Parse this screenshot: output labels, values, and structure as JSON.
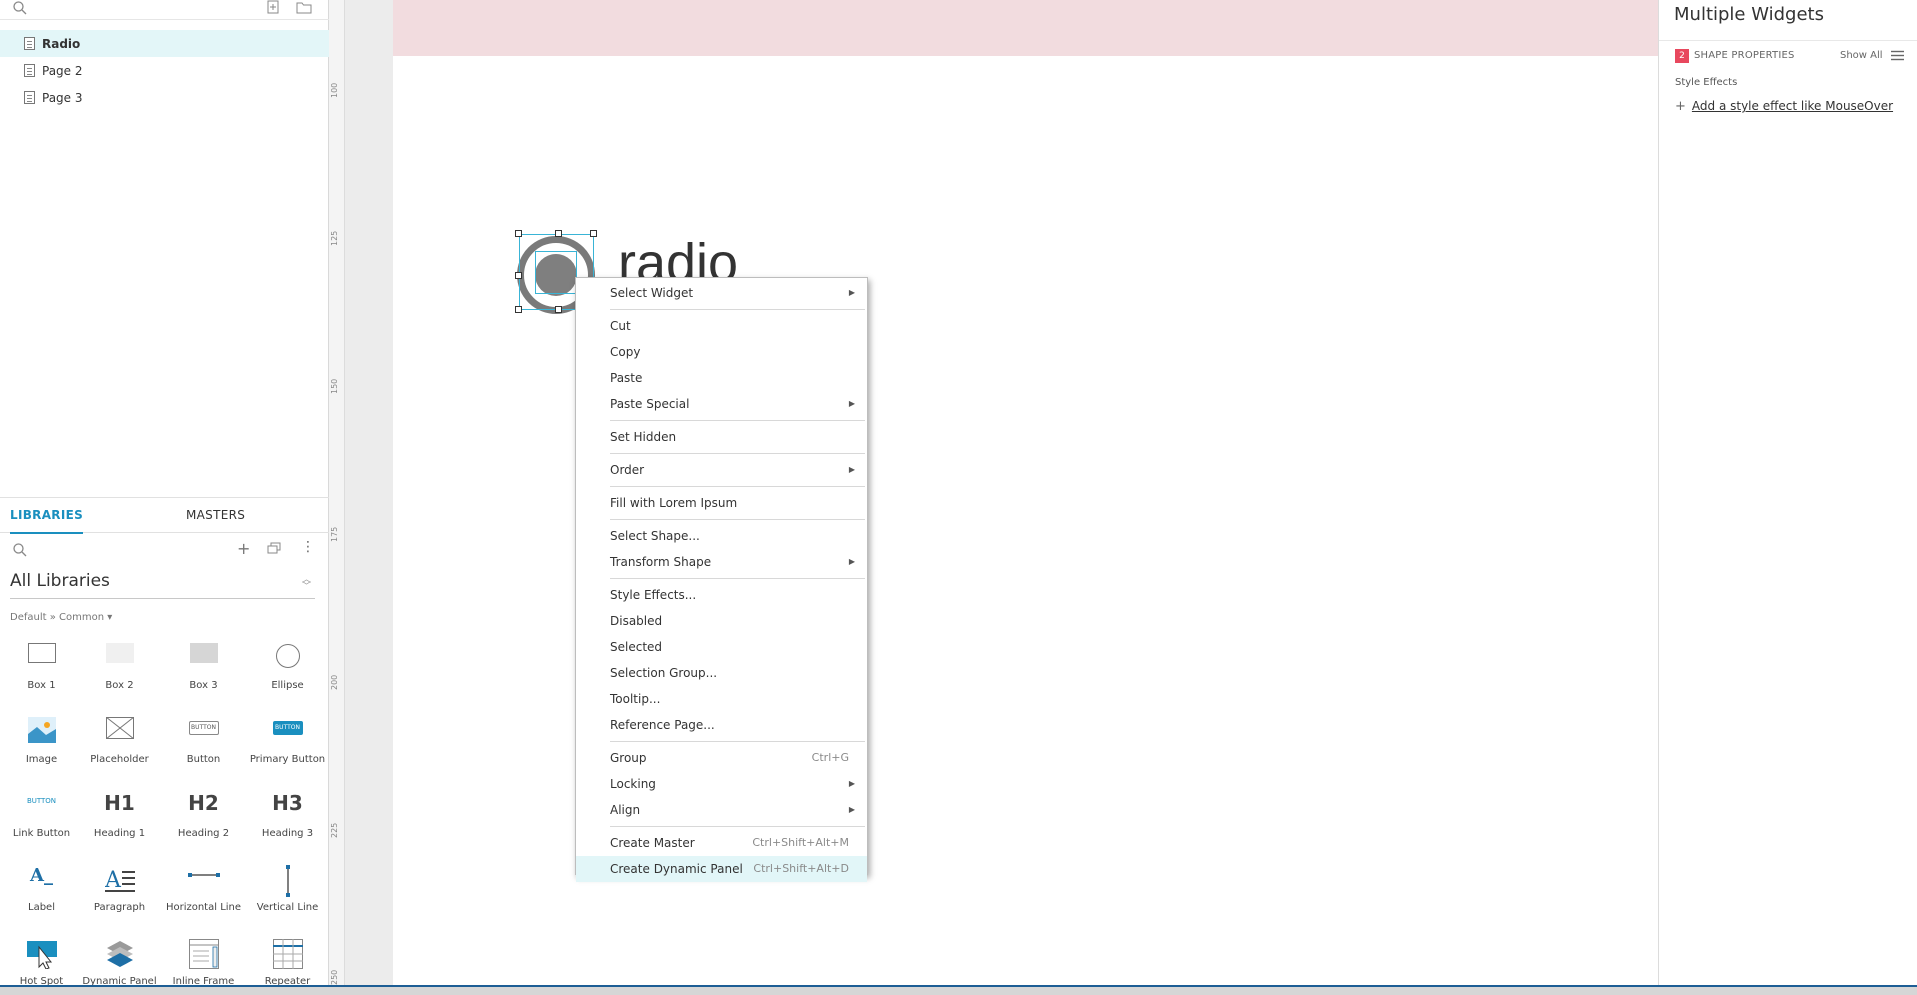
{
  "pages": [
    {
      "label": "Radio",
      "selected": true
    },
    {
      "label": "Page 2",
      "selected": false
    },
    {
      "label": "Page 3",
      "selected": false
    }
  ],
  "libraries": {
    "tabs": [
      "LIBRARIES",
      "MASTERS"
    ],
    "selected_library": "All Libraries",
    "breadcrumb": "Default » Common ▾",
    "widgets": [
      {
        "label": "Box 1",
        "icon": "box1-icon"
      },
      {
        "label": "Box 2",
        "icon": "box2-icon"
      },
      {
        "label": "Box 3",
        "icon": "box3-icon"
      },
      {
        "label": "Ellipse",
        "icon": "ellipse-icon"
      },
      {
        "label": "Image",
        "icon": "image-icon"
      },
      {
        "label": "Placeholder",
        "icon": "placeholder-icon"
      },
      {
        "label": "Button",
        "icon": "button-icon"
      },
      {
        "label": "Primary Button",
        "icon": "primary-button-icon"
      },
      {
        "label": "Link Button",
        "icon": "link-button-icon"
      },
      {
        "label": "Heading 1",
        "icon": "heading1-icon"
      },
      {
        "label": "Heading 2",
        "icon": "heading2-icon"
      },
      {
        "label": "Heading 3",
        "icon": "heading3-icon"
      },
      {
        "label": "Label",
        "icon": "label-icon"
      },
      {
        "label": "Paragraph",
        "icon": "paragraph-icon"
      },
      {
        "label": "Horizontal Line",
        "icon": "horizontal-line-icon"
      },
      {
        "label": "Vertical Line",
        "icon": "vertical-line-icon"
      },
      {
        "label": "Hot Spot",
        "icon": "hot-spot-icon"
      },
      {
        "label": "Dynamic Panel",
        "icon": "dynamic-panel-icon"
      },
      {
        "label": "Inline Frame",
        "icon": "inline-frame-icon"
      },
      {
        "label": "Repeater",
        "icon": "repeater-icon"
      }
    ],
    "icon_text": {
      "button": "BUTTON",
      "primary_button": "BUTTON",
      "link_button": "BUTTON",
      "h1": "H1",
      "h2": "H2",
      "h3": "H3",
      "label": "A_"
    }
  },
  "ruler_ticks": [
    "100",
    "125",
    "150",
    "175",
    "200",
    "225",
    "250"
  ],
  "canvas": {
    "radio_text": "radio"
  },
  "context_menu": {
    "groups": [
      [
        {
          "label": "Select Widget",
          "submenu": true
        }
      ],
      [
        {
          "label": "Cut"
        },
        {
          "label": "Copy"
        },
        {
          "label": "Paste"
        },
        {
          "label": "Paste Special",
          "submenu": true
        }
      ],
      [
        {
          "label": "Set Hidden"
        }
      ],
      [
        {
          "label": "Order",
          "submenu": true
        }
      ],
      [
        {
          "label": "Fill with Lorem Ipsum"
        }
      ],
      [
        {
          "label": "Select Shape..."
        },
        {
          "label": "Transform Shape",
          "submenu": true
        }
      ],
      [
        {
          "label": "Style Effects..."
        },
        {
          "label": "Disabled"
        },
        {
          "label": "Selected"
        },
        {
          "label": "Selection Group..."
        },
        {
          "label": "Tooltip..."
        },
        {
          "label": "Reference Page..."
        }
      ],
      [
        {
          "label": "Group",
          "shortcut": "Ctrl+G"
        },
        {
          "label": "Locking",
          "submenu": true
        },
        {
          "label": "Align",
          "submenu": true
        }
      ],
      [
        {
          "label": "Create Master",
          "shortcut": "Ctrl+Shift+Alt+M"
        },
        {
          "label": "Create Dynamic Panel",
          "shortcut": "Ctrl+Shift+Alt+D",
          "highlighted": true
        }
      ]
    ]
  },
  "right_panel": {
    "title": "Multiple Widgets",
    "badge": "2",
    "section": "SHAPE PROPERTIES",
    "show_all": "Show All",
    "style_effects": "Style Effects",
    "add_effect": "Add a style effect like MouseOver"
  },
  "colors": {
    "accent": "#1a8fbf",
    "selected_bg": "#e3f6f8",
    "badge": "#e8485e",
    "pink_band": "#f2dcdf"
  }
}
